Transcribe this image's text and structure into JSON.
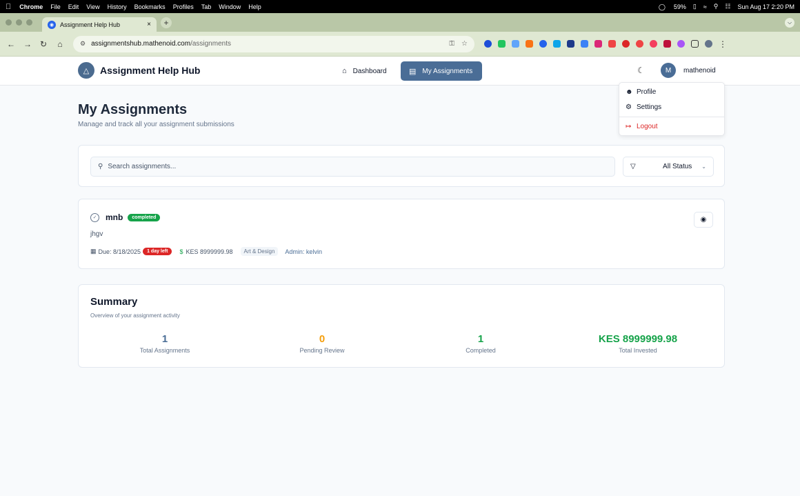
{
  "os_menubar": {
    "app": "Chrome",
    "items": [
      "File",
      "Edit",
      "View",
      "History",
      "Bookmarks",
      "Profiles",
      "Tab",
      "Window",
      "Help"
    ],
    "battery": "59%",
    "clock": "Sun Aug 17  2:20 PM"
  },
  "browser": {
    "tab_title": "Assignment Help Hub",
    "url_host": "assignmentshub.mathenoid.com",
    "url_path": "/assignments"
  },
  "header": {
    "brand": "Assignment Help Hub",
    "nav": [
      {
        "label": "Dashboard"
      },
      {
        "label": "My Assignments"
      }
    ],
    "avatar_initial": "M",
    "username": "mathenoid"
  },
  "user_menu": {
    "items": [
      {
        "label": "Profile"
      },
      {
        "label": "Settings"
      },
      {
        "label": "Logout"
      }
    ]
  },
  "page": {
    "title": "My Assignments",
    "subtitle": "Manage and track all your assignment submissions"
  },
  "filters": {
    "search_placeholder": "Search assignments...",
    "status_selected": "All Status"
  },
  "assignments": [
    {
      "title": "mnb",
      "status": "completed",
      "description": "jhgv",
      "due": "Due: 8/18/2025",
      "time_left": "1 day left",
      "amount": "KES 8999999.98",
      "category": "Art & Design",
      "admin": "Admin: kelvin"
    }
  ],
  "summary": {
    "title": "Summary",
    "subtitle": "Overview of your assignment activity",
    "stats": [
      {
        "value": "1",
        "label": "Total Assignments",
        "color": "#4a6d96"
      },
      {
        "value": "0",
        "label": "Pending Review",
        "color": "#f59e0b"
      },
      {
        "value": "1",
        "label": "Completed",
        "color": "#16a34a"
      },
      {
        "value": "KES 8999999.98",
        "label": "Total Invested",
        "color": "#16a34a"
      }
    ]
  },
  "colors": {
    "primary": "#4a6d96",
    "success": "#16a34a",
    "danger": "#dc2626",
    "warning": "#f59e0b"
  }
}
